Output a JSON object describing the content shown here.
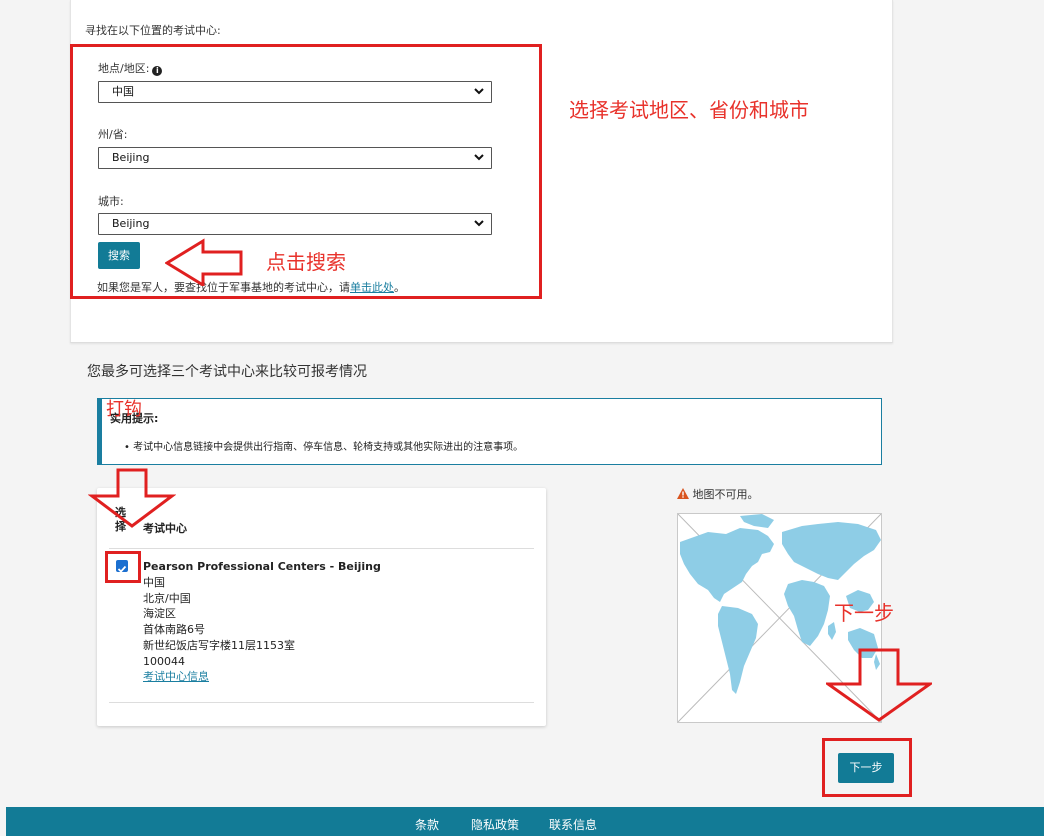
{
  "search": {
    "heading": "寻找在以下位置的考试中心:",
    "country_label": "地点/地区:",
    "country_value": "中国",
    "state_label": "州/省:",
    "state_value": "Beijing",
    "city_label": "城市:",
    "city_value": "Beijing",
    "search_button": "搜索",
    "military_text": "如果您是军人，要查找位于军事基地的考试中心，请",
    "military_link": "单击此处",
    "military_end": "。"
  },
  "compare_heading": "您最多可选择三个考试中心来比较可报考情况",
  "tip": {
    "title": "实用提示:",
    "bullet": "考试中心信息链接中会提供出行指南、停车信息、轮椅支持或其他实际进出的注意事项。"
  },
  "results": {
    "col_select": "选择",
    "col_center": "考试中心",
    "center": {
      "name": "Pearson Professional Centers - Beijing",
      "lines": [
        "中国",
        "北京/中国",
        "海淀区",
        "首体南路6号",
        "新世纪饭店写字楼11层1153室",
        "100044"
      ],
      "info_link": "考试中心信息",
      "checked": true
    }
  },
  "map": {
    "unavailable": "地图不可用。"
  },
  "next_button": "下一步",
  "footer": {
    "links": [
      "条款",
      "隐私政策",
      "联系信息"
    ]
  },
  "annotations": {
    "select_region": "选择考试地区、省份和城市",
    "click_search": "点击搜索",
    "check": "打钩",
    "next_step": "下一步"
  },
  "colors": {
    "accent": "#127b96",
    "annotation": "#e02020",
    "land": "#8ecde6"
  }
}
